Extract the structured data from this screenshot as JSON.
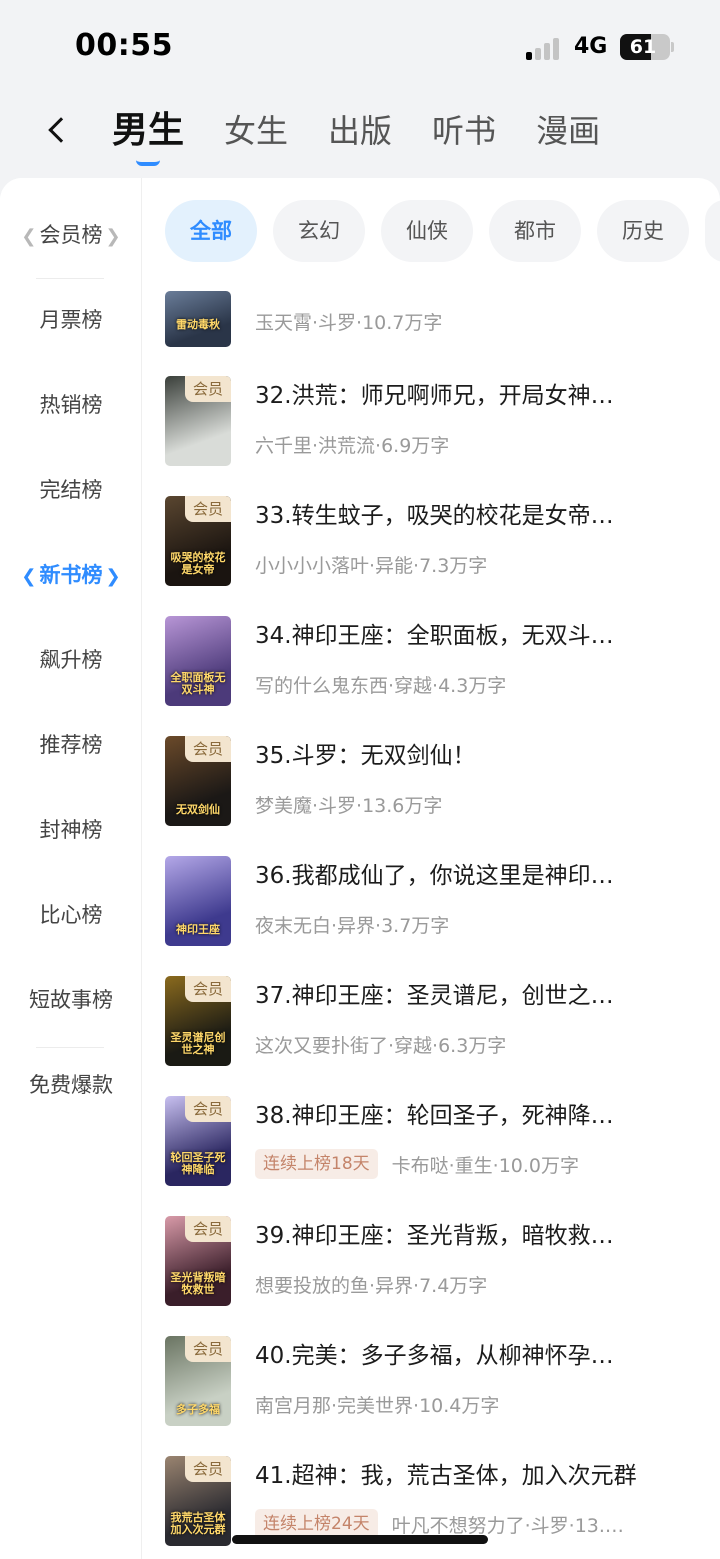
{
  "status_bar": {
    "time": "00:55",
    "network": "4G",
    "battery": "61",
    "signal_bars_on": 1,
    "signal_bars_total": 4
  },
  "top_tabs": [
    {
      "label": "男生",
      "active": true
    },
    {
      "label": "女生",
      "active": false
    },
    {
      "label": "出版",
      "active": false
    },
    {
      "label": "听书",
      "active": false
    },
    {
      "label": "漫画",
      "active": false
    }
  ],
  "sidebar": {
    "items": [
      {
        "label": "会员榜",
        "laurel": true,
        "active": false
      },
      {
        "label": "月票榜",
        "laurel": false,
        "active": false
      },
      {
        "label": "热销榜",
        "laurel": false,
        "active": false
      },
      {
        "label": "完结榜",
        "laurel": false,
        "active": false
      },
      {
        "label": "新书榜",
        "laurel": true,
        "active": true
      },
      {
        "label": "飙升榜",
        "laurel": false,
        "active": false
      },
      {
        "label": "推荐榜",
        "laurel": false,
        "active": false
      },
      {
        "label": "封神榜",
        "laurel": false,
        "active": false
      },
      {
        "label": "比心榜",
        "laurel": false,
        "active": false
      },
      {
        "label": "短故事榜",
        "laurel": false,
        "active": false
      },
      {
        "label": "免费爆款",
        "laurel": false,
        "active": false
      }
    ]
  },
  "categories": [
    {
      "label": "全部",
      "active": true
    },
    {
      "label": "玄幻",
      "active": false
    },
    {
      "label": "仙侠",
      "active": false
    },
    {
      "label": "都市",
      "active": false
    },
    {
      "label": "历史",
      "active": false
    }
  ],
  "colors": {
    "accent": "#2f8cff",
    "vip_badge_bg": "#f3e5cf",
    "streak_tag_bg": "#f7ece6"
  },
  "books": [
    {
      "title": "",
      "meta": "玉天霄·斗罗·10.7万字",
      "vip": false,
      "streak": "",
      "cover_text": "雷动毒秋",
      "cover_colors": [
        "#2a3548",
        "#6a7d99"
      ]
    },
    {
      "title": "32.洪荒：师兄啊师兄，开局女神…",
      "meta": "六千里·洪荒流·6.9万字",
      "vip": true,
      "streak": "",
      "cover_text": "",
      "cover_colors": [
        "#d9dcd8",
        "#3a3f3a"
      ]
    },
    {
      "title": "33.转生蚊子，吸哭的校花是女帝…",
      "meta": "小小小小落叶·异能·7.3万字",
      "vip": true,
      "streak": "",
      "cover_text": "吸哭的校花是女帝",
      "cover_colors": [
        "#1a1410",
        "#5a4630"
      ]
    },
    {
      "title": "34.神印王座：全职面板，无双斗…",
      "meta": "写的什么鬼东西·穿越·4.3万字",
      "vip": false,
      "streak": "",
      "cover_text": "全职面板无双斗神",
      "cover_colors": [
        "#4c3a7a",
        "#b896d6"
      ]
    },
    {
      "title": "35.斗罗：无双剑仙！",
      "meta": "梦美魔·斗罗·13.6万字",
      "vip": true,
      "streak": "",
      "cover_text": "无双剑仙",
      "cover_colors": [
        "#1b1816",
        "#6b4a2a"
      ]
    },
    {
      "title": "36.我都成仙了，你说这里是神印…",
      "meta": "夜末无白·异界·3.7万字",
      "vip": false,
      "streak": "",
      "cover_text": "神印王座",
      "cover_colors": [
        "#3e3a8e",
        "#b4a8e8"
      ]
    },
    {
      "title": "37.神印王座：圣灵谱尼，创世之…",
      "meta": "这次又要扑街了·穿越·6.3万字",
      "vip": true,
      "streak": "",
      "cover_text": "圣灵谱尼创世之神",
      "cover_colors": [
        "#1a1a14",
        "#8a6a1e"
      ]
    },
    {
      "title": "38.神印王座：轮回圣子，死神降…",
      "meta": "卡布哒·重生·10.0万字",
      "vip": true,
      "streak": "连续上榜18天",
      "cover_text": "轮回圣子死神降临",
      "cover_colors": [
        "#2a2660",
        "#c8c0f0"
      ]
    },
    {
      "title": "39.神印王座：圣光背叛，暗牧救…",
      "meta": "想要投放的鱼·异界·7.4万字",
      "vip": true,
      "streak": "",
      "cover_text": "圣光背叛暗牧救世",
      "cover_colors": [
        "#3a1e2a",
        "#d89aa8"
      ]
    },
    {
      "title": "40.完美：多子多福，从柳神怀孕…",
      "meta": "南宫月那·完美世界·10.4万字",
      "vip": true,
      "streak": "",
      "cover_text": "多子多福",
      "cover_colors": [
        "#c8d0c4",
        "#6a7462"
      ]
    },
    {
      "title": "41.超神：我，荒古圣体，加入次元群",
      "meta": "叶凡不想努力了·斗罗·13.…",
      "vip": true,
      "streak": "连续上榜24天",
      "cover_text": "我荒古圣体加入次元群",
      "cover_colors": [
        "#2a2a30",
        "#9a8470"
      ]
    }
  ]
}
